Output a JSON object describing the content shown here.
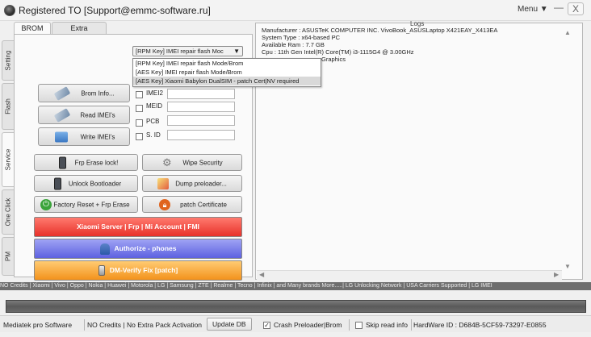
{
  "window": {
    "title": "Registered TO [Support@emmc-software.ru]",
    "menu_label": "Menu ▼",
    "minimize": "—",
    "close": "X"
  },
  "top_tabs": [
    {
      "label": "BROM",
      "active": true
    },
    {
      "label": "Extra",
      "active": false
    }
  ],
  "side_tabs": [
    {
      "label": "Setting",
      "active": false
    },
    {
      "label": "Flash",
      "active": false
    },
    {
      "label": "Service",
      "active": true
    },
    {
      "label": "One Click",
      "active": false
    },
    {
      "label": "PM",
      "active": false
    }
  ],
  "mode_select": {
    "selected": "[RPM Key] IMEI repair flash Moc",
    "options": [
      "[RPM Key] IMEI repair flash Mode/Brom",
      "[AES Key] IMEI repair flash Mode/Brom",
      "[AES Key] Xiaomi Babylon DualSIM - patch Cert|NV required"
    ],
    "highlighted_index": 2
  },
  "imei_buttons": {
    "brom_info": "Brom Info...",
    "read_imei": "Read IMEI's",
    "write_imei": "Write IMEI's"
  },
  "fields": {
    "imei2": "IMEI2",
    "meid": "MEID",
    "pcb": "PCB",
    "sid": "S. ID"
  },
  "service_buttons": {
    "frp_erase": "Frp Erase lock!",
    "wipe_security": "Wipe Security",
    "unlock_bootloader": "Unlock Bootloader",
    "dump_preloader": "Dump preloader...",
    "factory_reset": "Factory Reset + Frp Erase",
    "patch_certificate": "patch Certificate"
  },
  "bars": {
    "xiaomi": "Xiaomi Server | Frp | Mi Account | FMI",
    "authorize": "Authorize - phones",
    "dm_verify": "DM-Verify Fix [patch]"
  },
  "logs": {
    "title": "Logs",
    "lines": [
      "Manufacturer : ASUSTeK COMPUTER INC. VivoBook_ASUSLaptop X421EAY_X413EA",
      "System Type : x64-based PC",
      "Available Ram : 7.7 GB",
      "Cpu : 11th Gen Intel(R) Core(TM) i3-1115G4 @ 3.00GHz",
      "Graphics"
    ]
  },
  "marquee": "NO Credits | Xiaomi | Vivo | Oppo | Nokia | Huawei | Motorola | LG | Samsung | ZTE | Realme | Tecno | Infinix | and Many brands More.....| LG Unlocking Network | USA Carriers Supported | LG IMEI",
  "status": {
    "software": "Mediatek pro Software",
    "credits": "NO Credits | No Extra Pack Activation",
    "update_db": "Update DB",
    "crash_preloader": "Crash Preloader|Brom",
    "crash_checked": true,
    "skip_read_info": "Skip read info",
    "skip_checked": false,
    "hardware_id": "HardWare ID : D684B-5CF59-73297-E0855"
  },
  "colors": {
    "red_bar": "#e8312a",
    "blue_bar": "#5d61e0",
    "orange_bar": "#f3921c",
    "progress": "#6a6a6a"
  }
}
